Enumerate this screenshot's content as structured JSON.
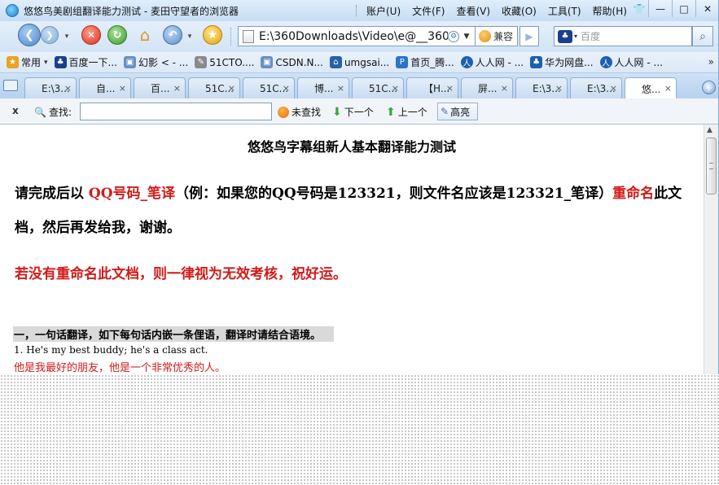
{
  "window": {
    "title": "悠悠鸟美剧组翻译能力测试 - 麦田守望者的浏览器",
    "menu": [
      "账户(U)",
      "文件(F)",
      "查看(V)",
      "收藏(O)",
      "工具(T)",
      "帮助(H)"
    ],
    "min": "—",
    "max": "□",
    "close": "✕"
  },
  "nav": {
    "address": "E:\\360Downloads\\Video\\e@__360[",
    "compat_label": "兼容",
    "search_placeholder": "百度"
  },
  "bookmarks": [
    {
      "label": "常用",
      "icon": "star-icon",
      "color": "#e9a320",
      "glyph": "★"
    },
    {
      "label": "百度一下...",
      "icon": "baidu-paw-icon",
      "color": "#1b3f8c",
      "glyph": "♣"
    },
    {
      "label": "幻影 < - ...",
      "icon": "page-icon",
      "color": "#6a8fbf",
      "glyph": "▣"
    },
    {
      "label": "51CTO....",
      "icon": "clip-icon",
      "color": "#8a8a8a",
      "glyph": "✎"
    },
    {
      "label": "CSDN.N...",
      "icon": "page-icon",
      "color": "#6a8fbf",
      "glyph": "▣"
    },
    {
      "label": "umgsai...",
      "icon": "house-icon",
      "color": "#2b5fa8",
      "glyph": "⌂"
    },
    {
      "label": "首页_腾...",
      "icon": "page-icon",
      "color": "#2b74c7",
      "glyph": "P"
    },
    {
      "label": "人人网 - ...",
      "icon": "renren-icon",
      "color": "#1d5fb0",
      "glyph": "人"
    },
    {
      "label": "华为网盘...",
      "icon": "huawei-paw-icon",
      "color": "#1d5fb0",
      "glyph": "♣"
    },
    {
      "label": "人人网 - ...",
      "icon": "renren-icon",
      "color": "#1d5fb0",
      "glyph": "人"
    }
  ],
  "bookmarks_more": "»",
  "tabs": [
    "E:\\3...",
    "自...",
    "百...",
    "51C...",
    "51C...",
    "博...",
    "51C...",
    "【H...",
    "屏...",
    "E:\\3...",
    "E:\\3...",
    "悠..."
  ],
  "tab_close": "×",
  "findbar": {
    "close": "x",
    "label": "查找:",
    "value": "",
    "status": "未查找",
    "next": "下一个",
    "prev": "上一个",
    "highlight": "高亮"
  },
  "doc": {
    "title": "悠悠鸟字幕组新人基本翻译能力测试",
    "instr_pre": "请完成后以 ",
    "instr_red1": "QQ号码_笔译",
    "instr_mid": "（例：如果您的QQ号码是123321，则文件名应该是123321_笔译）",
    "instr_red2": "重命名",
    "instr_post": "此文档，然后再发给我，谢谢。",
    "warning": "若没有重命名此文档，则一律视为无效考核，祝好运。",
    "section1": "一，一句话翻译，如下每句话内嵌一条俚语，翻译时请结合语境。",
    "item1": "1.   He's my best buddy; he's a class act.",
    "item1_translation": "他是我最好的朋友，他是一个非常优秀的人。"
  }
}
